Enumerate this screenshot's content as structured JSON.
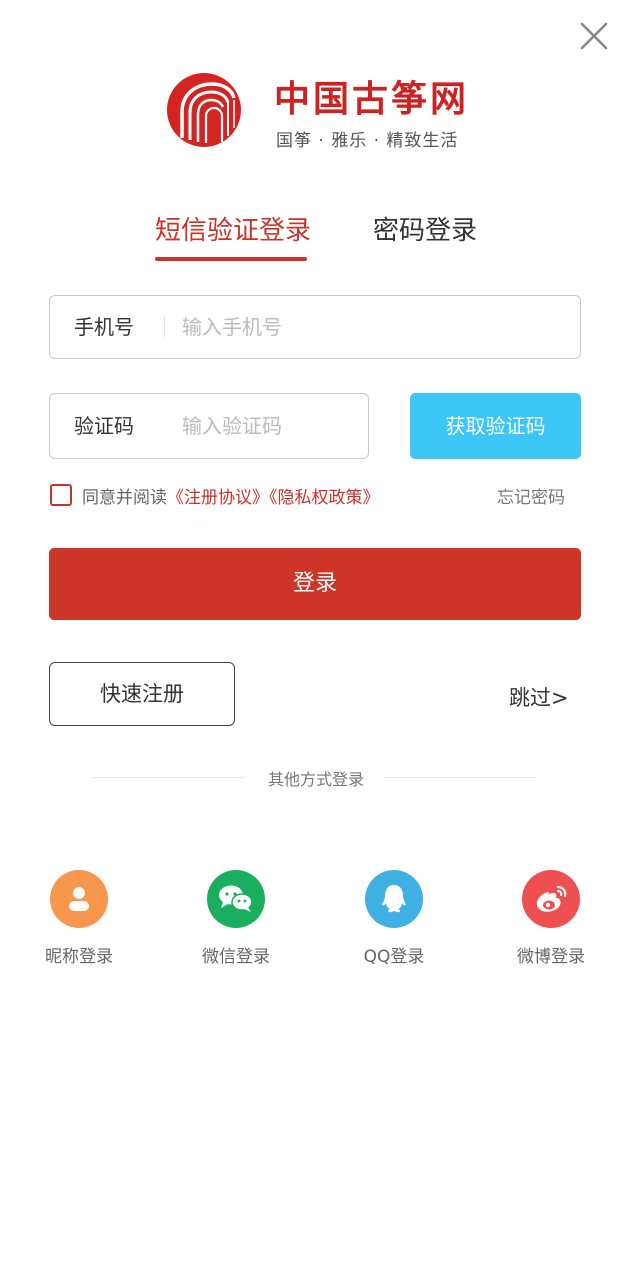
{
  "colors": {
    "accent": "#c8332a",
    "code_button": "#3cc6f5",
    "login_button": "#cd3528"
  },
  "brand": {
    "name": "中国古筝网",
    "slogan": "国筝 · 雅乐 · 精致生活"
  },
  "tabs": [
    {
      "label": "短信验证登录",
      "active": true
    },
    {
      "label": "密码登录",
      "active": false
    }
  ],
  "phone": {
    "label": "手机号",
    "placeholder": "输入手机号",
    "value": ""
  },
  "code": {
    "label": "验证码",
    "placeholder": "输入验证码",
    "value": "",
    "button": "获取验证码"
  },
  "agreement": {
    "prefix": "同意并阅读",
    "terms": "《注册协议》",
    "privacy": "《隐私权政策》",
    "checked": false
  },
  "forgot": "忘记密码",
  "login": "登录",
  "register": "快速注册",
  "skip": "跳过>",
  "other_title": "其他方式登录",
  "social": [
    {
      "label": "昵称登录",
      "icon": "user-icon",
      "color": "#f7964d"
    },
    {
      "label": "微信登录",
      "icon": "wechat-icon",
      "color": "#1aae5f"
    },
    {
      "label": "QQ登录",
      "icon": "qq-icon",
      "color": "#3fb0e4"
    },
    {
      "label": "微博登录",
      "icon": "weibo-icon",
      "color": "#ee5050"
    }
  ]
}
